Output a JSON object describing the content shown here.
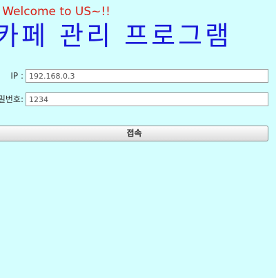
{
  "header": {
    "welcome": "Welcome to US~!!",
    "title": "카페 관리 프로그램"
  },
  "form": {
    "ip_label": "IP :",
    "ip_value": "192.168.0.3",
    "password_label": "비밀번호:",
    "password_value": "1234",
    "connect_label": "접속"
  },
  "colors": {
    "background": "#d4fefe",
    "welcome_text": "#d81e14",
    "title_text": "#1818d8"
  }
}
